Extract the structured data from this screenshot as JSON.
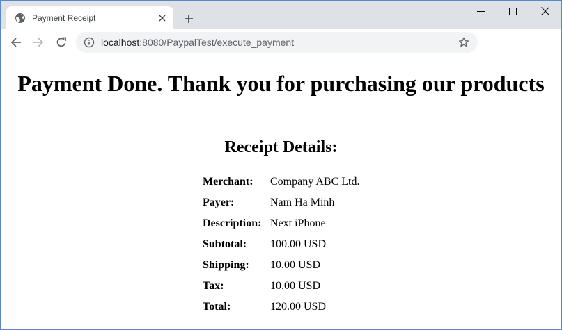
{
  "browser": {
    "tab_title": "Payment Receipt",
    "url_host": "localhost",
    "url_rest": ":8080/PaypalTest/execute_payment"
  },
  "page": {
    "heading": "Payment Done. Thank you for purchasing our products",
    "receipt_title": "Receipt Details:",
    "rows": [
      {
        "label": "Merchant:",
        "value": "Company ABC Ltd."
      },
      {
        "label": "Payer:",
        "value": "Nam Ha Minh"
      },
      {
        "label": "Description:",
        "value": "Next iPhone"
      },
      {
        "label": "Subtotal:",
        "value": "100.00 USD"
      },
      {
        "label": "Shipping:",
        "value": "10.00 USD"
      },
      {
        "label": "Tax:",
        "value": "10.00 USD"
      },
      {
        "label": "Total:",
        "value": "120.00 USD"
      }
    ]
  },
  "icons": {
    "favicon": "globe-icon",
    "tab_close": "close-icon",
    "new_tab": "plus-icon",
    "back": "arrow-left-icon",
    "forward": "arrow-right-icon",
    "reload": "reload-icon",
    "site_info": "info-icon",
    "bookmark": "star-icon",
    "minimize": "minimize-icon",
    "maximize": "maximize-icon",
    "close": "window-close-icon"
  }
}
